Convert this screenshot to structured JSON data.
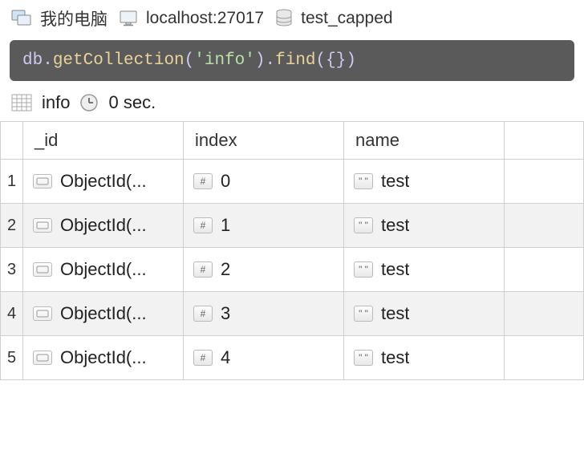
{
  "breadcrumb": {
    "computer": "我的电脑",
    "host": "localhost:27017",
    "database": "test_capped"
  },
  "query": {
    "db": "db",
    "fn1": "getCollection",
    "arg1": "'info'",
    "fn2": "find",
    "arg2": "{}"
  },
  "meta": {
    "collection": "info",
    "timing": "0 sec."
  },
  "table": {
    "columns": [
      "_id",
      "index",
      "name"
    ],
    "rows": [
      {
        "n": "1",
        "id": "ObjectId(...",
        "index": "0",
        "name": "test"
      },
      {
        "n": "2",
        "id": "ObjectId(...",
        "index": "1",
        "name": "test"
      },
      {
        "n": "3",
        "id": "ObjectId(...",
        "index": "2",
        "name": "test"
      },
      {
        "n": "4",
        "id": "ObjectId(...",
        "index": "3",
        "name": "test"
      },
      {
        "n": "5",
        "id": "ObjectId(...",
        "index": "4",
        "name": "test"
      }
    ]
  }
}
